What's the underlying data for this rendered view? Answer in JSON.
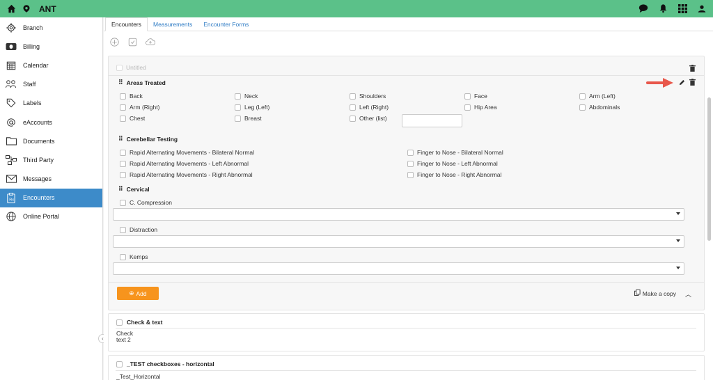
{
  "app": {
    "title": "ANT"
  },
  "topbar": {
    "icons": [
      "home-icon",
      "location-pin-icon",
      "chat-icon",
      "bell-icon",
      "apps-grid-icon",
      "user-icon"
    ]
  },
  "sidebar": {
    "items": [
      {
        "label": "Branch",
        "icon": "gear-icon"
      },
      {
        "label": "Billing",
        "icon": "money-icon"
      },
      {
        "label": "Calendar",
        "icon": "calendar-icon"
      },
      {
        "label": "Staff",
        "icon": "staff-icon"
      },
      {
        "label": "Labels",
        "icon": "tag-icon"
      },
      {
        "label": "eAccounts",
        "icon": "at-icon"
      },
      {
        "label": "Documents",
        "icon": "folder-icon"
      },
      {
        "label": "Third Party",
        "icon": "network-icon"
      },
      {
        "label": "Messages",
        "icon": "envelope-icon"
      },
      {
        "label": "Encounters",
        "icon": "clipboard-icon",
        "active": true
      },
      {
        "label": "Online Portal",
        "icon": "globe-icon"
      }
    ]
  },
  "tabs": [
    {
      "label": "Encounters",
      "active": true
    },
    {
      "label": "Measurements"
    },
    {
      "label": "Encounter Forms"
    }
  ],
  "form": {
    "title_placeholder": "Untitled",
    "areas": {
      "title": "Areas Treated",
      "options": [
        "Back",
        "Neck",
        "Shoulders",
        "Face",
        "Arm (Left)",
        "Arm (Right)",
        "Leg (Left)",
        "Left (Right)",
        "Hip Area",
        "Abdominals",
        "Chest",
        "Breast",
        "Other (list)"
      ]
    },
    "cerebellar": {
      "title": "Cerebellar Testing",
      "options": [
        "Rapid Alternating Movements - Bilateral Normal",
        "Finger to Nose - Bilateral Normal",
        "Rapid Alternating Movements - Left Abnormal",
        "Finger to Nose - Left Abnormal",
        "Rapid Alternating Movements - Right Abnormal",
        "Finger to Nose - Right Abnormal"
      ]
    },
    "cervical": {
      "title": "Cervical",
      "options": [
        "C. Compression",
        "Distraction",
        "Kemps"
      ]
    },
    "add_label": "Add",
    "copy_label": "Make a copy"
  },
  "cards": [
    {
      "title": "Check & text",
      "lines": [
        "Check",
        "text 2"
      ]
    },
    {
      "title": "_TEST checkboxes - horizontal",
      "lines": [
        "_Test_Horizontal"
      ]
    }
  ],
  "colors": {
    "topbar": "#5bc189",
    "active": "#3d8bc9",
    "add": "#f7941d",
    "arrow": "#e8574b"
  }
}
